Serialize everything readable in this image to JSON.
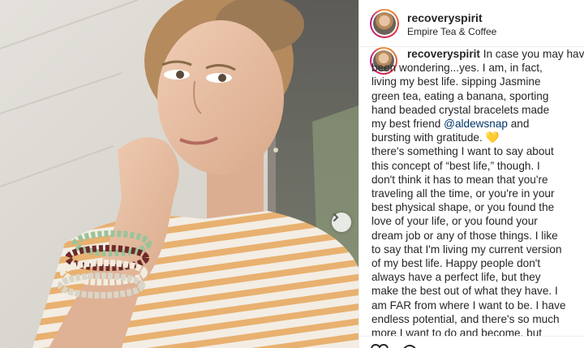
{
  "post": {
    "username": "recoveryspirit",
    "location": "Empire Tea & Coffee"
  },
  "caption": {
    "lines": [
      {
        "prefix": "recoveryspirit",
        "text": " In case you may have"
      },
      {
        "text": "been wondering...yes. I am, in fact,"
      },
      {
        "text": "living my best life. sipping Jasmine"
      },
      {
        "text": "green tea, eating a banana, sporting"
      },
      {
        "text": "hand beaded crystal bracelets made"
      },
      {
        "text": "my best friend ",
        "mention": "@aldewsnap",
        "suffix": " and"
      },
      {
        "text": "bursting with gratitude. 💛"
      },
      {
        "text": "there's something I want to say about"
      },
      {
        "text": "this concept of “best life,” though. I"
      },
      {
        "text": "don't think it has to mean that you're"
      },
      {
        "text": "traveling all the time, or you're in your"
      },
      {
        "text": "best physical shape, or you found the"
      },
      {
        "text": "love of your life, or you found your"
      },
      {
        "text": "dream job or any of those things. I like"
      },
      {
        "text": "to say that I'm living my current version"
      },
      {
        "text": "of my best life. Happy people don't"
      },
      {
        "text": "always have a perfect life, but they"
      },
      {
        "text": "make the best out of what they have. I"
      },
      {
        "text": "am FAR from where I want to be. I have"
      },
      {
        "text": "endless potential, and there's so much"
      },
      {
        "text": "more I want to do and become, but"
      }
    ]
  },
  "icons": {
    "next": "chevron-right-icon",
    "like": "heart-icon",
    "comment": "comment-icon",
    "share": "share-icon",
    "save": "bookmark-icon"
  },
  "colors": {
    "text": "#262626",
    "mention": "#003569",
    "border": "#efefef",
    "active_dot": "#3897f0"
  }
}
